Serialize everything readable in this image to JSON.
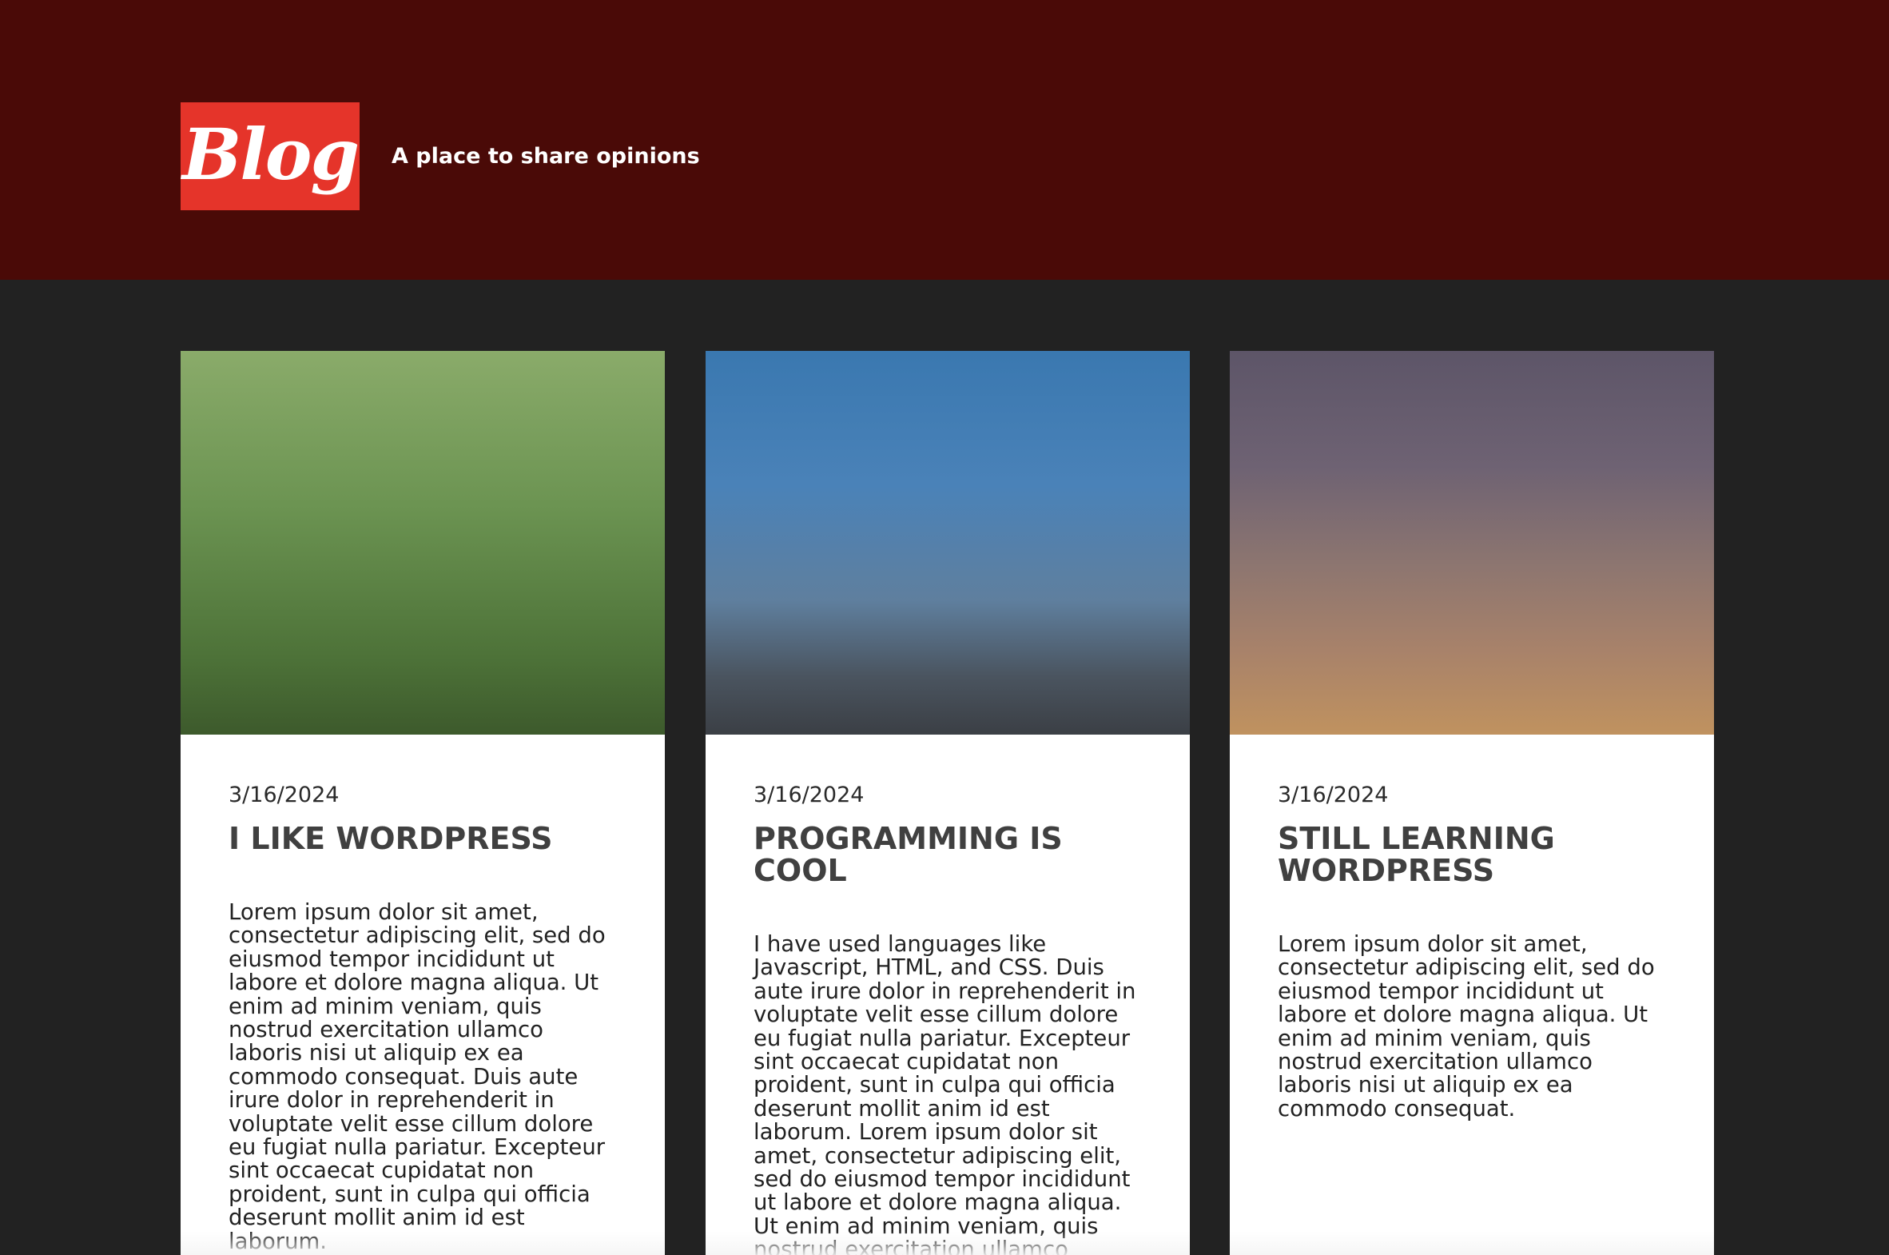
{
  "header": {
    "logo": "Blog",
    "tagline": "A place to share opinions"
  },
  "posts": [
    {
      "date": "3/16/2024",
      "title": "I LIKE WORDPRESS",
      "body": "Lorem ipsum dolor sit amet, consectetur adipiscing elit, sed do eiusmod tempor incididunt ut labore et dolore magna aliqua. Ut enim ad minim veniam, quis nostrud exercitation ullamco laboris nisi ut aliquip ex ea commodo consequat. Duis aute irure dolor in reprehenderit in voluptate velit esse cillum dolore eu fugiat nulla pariatur. Excepteur sint occaecat cupidatat non proident, sunt in culpa qui officia deserunt mollit anim id est laborum."
    },
    {
      "date": "3/16/2024",
      "title": "PROGRAMMING IS COOL",
      "body": "I have used languages like Javascript, HTML, and CSS. Duis aute irure dolor in reprehenderit in voluptate velit esse cillum dolore eu fugiat nulla pariatur. Excepteur sint occaecat cupidatat non proident, sunt in culpa qui officia deserunt mollit anim id est laborum. Lorem ipsum dolor sit amet, consectetur adipiscing elit, sed do eiusmod tempor incididunt ut labore et dolore magna aliqua. Ut enim ad minim veniam, quis nostrud exercitation ullamco laboris nisi ut aliquip ex ea commodo consequat."
    },
    {
      "date": "3/16/2024",
      "title": "STILL LEARNING WORDPRESS",
      "body": "Lorem ipsum dolor sit amet, consectetur adipiscing elit, sed do eiusmod tempor incididunt ut labore et dolore magna aliqua. Ut enim ad minim veniam, quis nostrud exercitation ullamco laboris nisi ut aliquip ex ea commodo consequat."
    }
  ],
  "colors": {
    "header_bg": "#4a0a07",
    "logo_bg": "#e5342a",
    "page_bg": "#222222",
    "card_bg": "#ffffff",
    "title_text": "#404040"
  }
}
